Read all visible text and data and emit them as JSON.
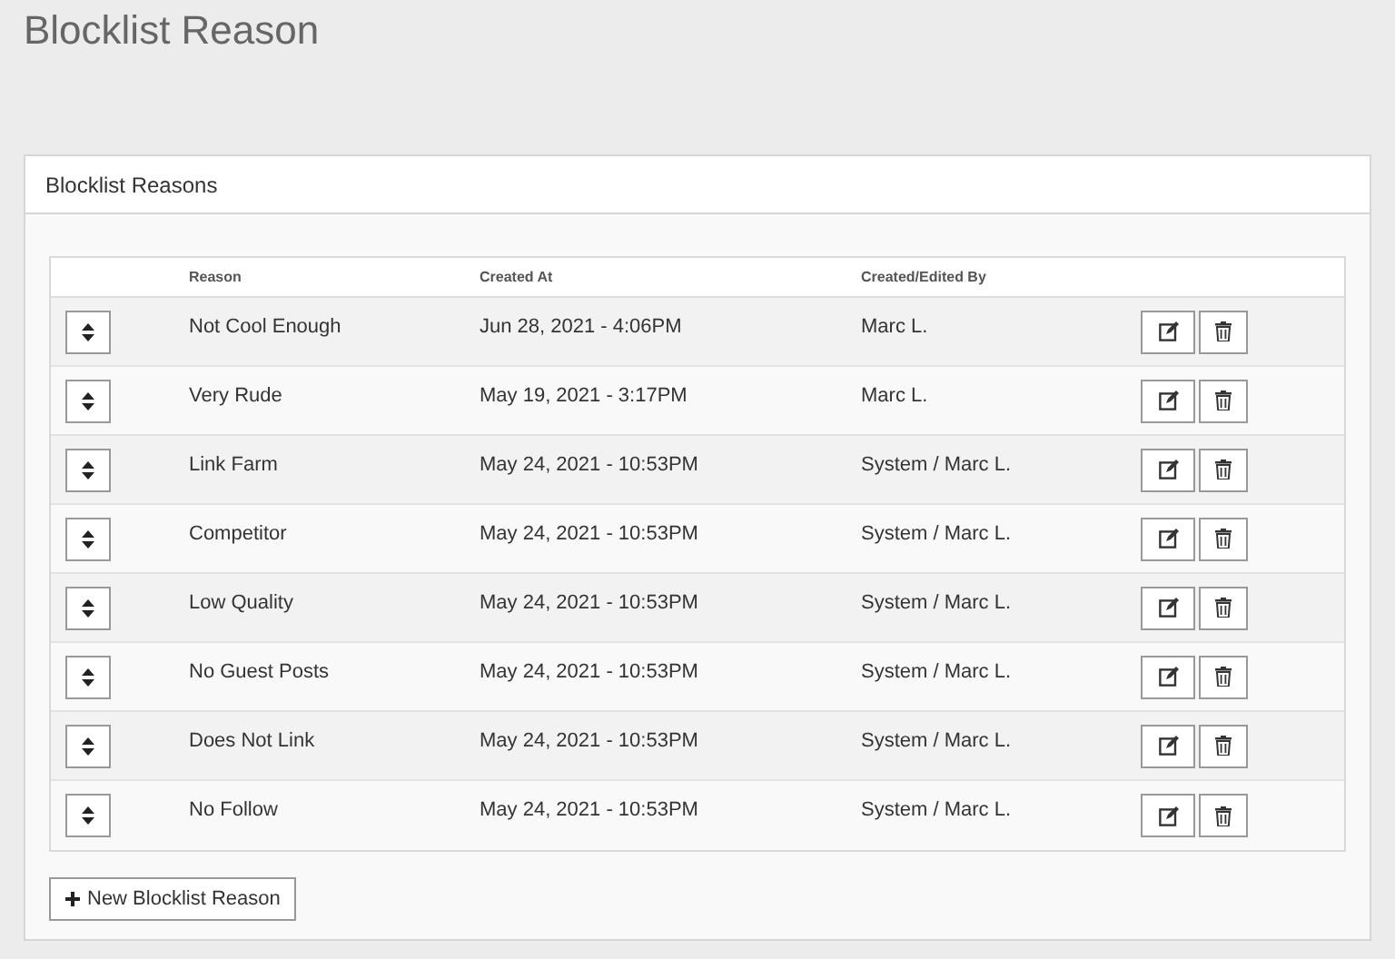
{
  "page": {
    "title": "Blocklist Reason"
  },
  "panel": {
    "title": "Blocklist Reasons"
  },
  "table": {
    "columns": [
      "Reason",
      "Created At",
      "Created/Edited By"
    ],
    "rows": [
      {
        "reason": "Not Cool Enough",
        "created_at": "Jun 28, 2021 - 4:06PM",
        "created_by": "Marc L."
      },
      {
        "reason": "Very Rude",
        "created_at": "May 19, 2021 - 3:17PM",
        "created_by": "Marc L."
      },
      {
        "reason": "Link Farm",
        "created_at": "May 24, 2021 - 10:53PM",
        "created_by": "System / Marc L."
      },
      {
        "reason": "Competitor",
        "created_at": "May 24, 2021 - 10:53PM",
        "created_by": "System / Marc L."
      },
      {
        "reason": "Low Quality",
        "created_at": "May 24, 2021 - 10:53PM",
        "created_by": "System / Marc L."
      },
      {
        "reason": "No Guest Posts",
        "created_at": "May 24, 2021 - 10:53PM",
        "created_by": "System / Marc L."
      },
      {
        "reason": "Does Not Link",
        "created_at": "May 24, 2021 - 10:53PM",
        "created_by": "System / Marc L."
      },
      {
        "reason": "No Follow",
        "created_at": "May 24, 2021 - 10:53PM",
        "created_by": "System / Marc L."
      }
    ]
  },
  "add_button": {
    "label": "New Blocklist Reason"
  }
}
